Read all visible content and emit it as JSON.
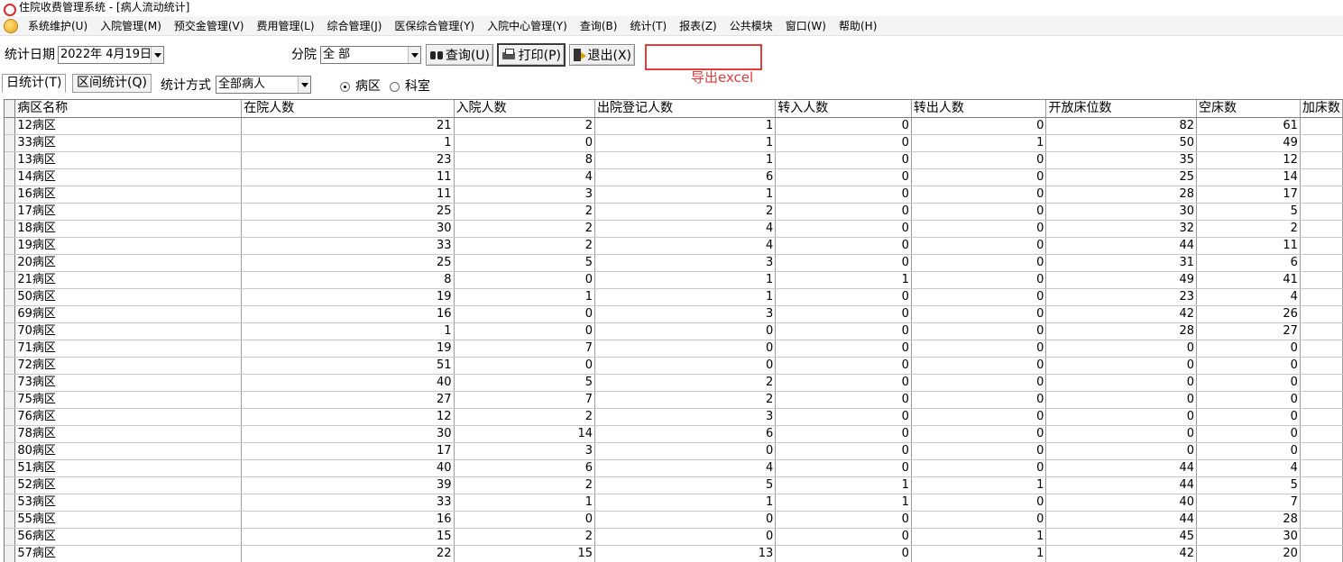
{
  "window": {
    "title": "住院收费管理系统 - [病人流动统计]"
  },
  "menu": [
    "系统维护(U)",
    "入院管理(M)",
    "预交金管理(V)",
    "费用管理(L)",
    "综合管理(J)",
    "医保综合管理(Y)",
    "入院中心管理(Y)",
    "查询(B)",
    "统计(T)",
    "报表(Z)",
    "公共模块",
    "窗口(W)",
    "帮助(H)"
  ],
  "toolbar": {
    "date_label": "统计日期",
    "date_value": "2022年  4月19日",
    "branch_label": "分院",
    "branch_value": "全 部",
    "query_label": "查询(U)",
    "print_label": "打印(P)",
    "exit_label": "退出(X)"
  },
  "annotation": {
    "text": "导出excel",
    "color": "#e23b3b"
  },
  "toolbar2": {
    "tab_daily": "日统计(T)",
    "tab_range": "区间统计(Q)",
    "method_label": "统计方式",
    "method_value": "全部病人",
    "radio_ward": "病区",
    "radio_dept": "科室",
    "selected_radio": "病区"
  },
  "table": {
    "columns": [
      "病区名称",
      "在院人数",
      "入院人数",
      "出院登记人数",
      "转入人数",
      "转出人数",
      "开放床位数",
      "空床数",
      "加床数"
    ],
    "rows": [
      [
        "12病区",
        21,
        2,
        1,
        0,
        0,
        82,
        61
      ],
      [
        "33病区",
        1,
        0,
        1,
        0,
        1,
        50,
        49
      ],
      [
        "13病区",
        23,
        8,
        1,
        0,
        0,
        35,
        12
      ],
      [
        "14病区",
        11,
        4,
        6,
        0,
        0,
        25,
        14
      ],
      [
        "16病区",
        11,
        3,
        1,
        0,
        0,
        28,
        17
      ],
      [
        "17病区",
        25,
        2,
        2,
        0,
        0,
        30,
        5
      ],
      [
        "18病区",
        30,
        2,
        4,
        0,
        0,
        32,
        2
      ],
      [
        "19病区",
        33,
        2,
        4,
        0,
        0,
        44,
        11
      ],
      [
        "20病区",
        25,
        5,
        3,
        0,
        0,
        31,
        6
      ],
      [
        "21病区",
        8,
        0,
        1,
        1,
        0,
        49,
        41
      ],
      [
        "50病区",
        19,
        1,
        1,
        0,
        0,
        23,
        4
      ],
      [
        "69病区",
        16,
        0,
        3,
        0,
        0,
        42,
        26
      ],
      [
        "70病区",
        1,
        0,
        0,
        0,
        0,
        28,
        27
      ],
      [
        "71病区",
        19,
        7,
        0,
        0,
        0,
        0,
        0
      ],
      [
        "72病区",
        51,
        0,
        0,
        0,
        0,
        0,
        0
      ],
      [
        "73病区",
        40,
        5,
        2,
        0,
        0,
        0,
        0
      ],
      [
        "75病区",
        27,
        7,
        2,
        0,
        0,
        0,
        0
      ],
      [
        "76病区",
        12,
        2,
        3,
        0,
        0,
        0,
        0
      ],
      [
        "78病区",
        30,
        14,
        6,
        0,
        0,
        0,
        0
      ],
      [
        "80病区",
        17,
        3,
        0,
        0,
        0,
        0,
        0
      ],
      [
        "51病区",
        40,
        6,
        4,
        0,
        0,
        44,
        4
      ],
      [
        "52病区",
        39,
        2,
        5,
        1,
        1,
        44,
        5
      ],
      [
        "53病区",
        33,
        1,
        1,
        1,
        0,
        40,
        7
      ],
      [
        "55病区",
        16,
        0,
        0,
        0,
        0,
        44,
        28
      ],
      [
        "56病区",
        15,
        2,
        0,
        0,
        1,
        45,
        30
      ],
      [
        "57病区",
        22,
        15,
        13,
        0,
        1,
        42,
        20
      ]
    ]
  }
}
